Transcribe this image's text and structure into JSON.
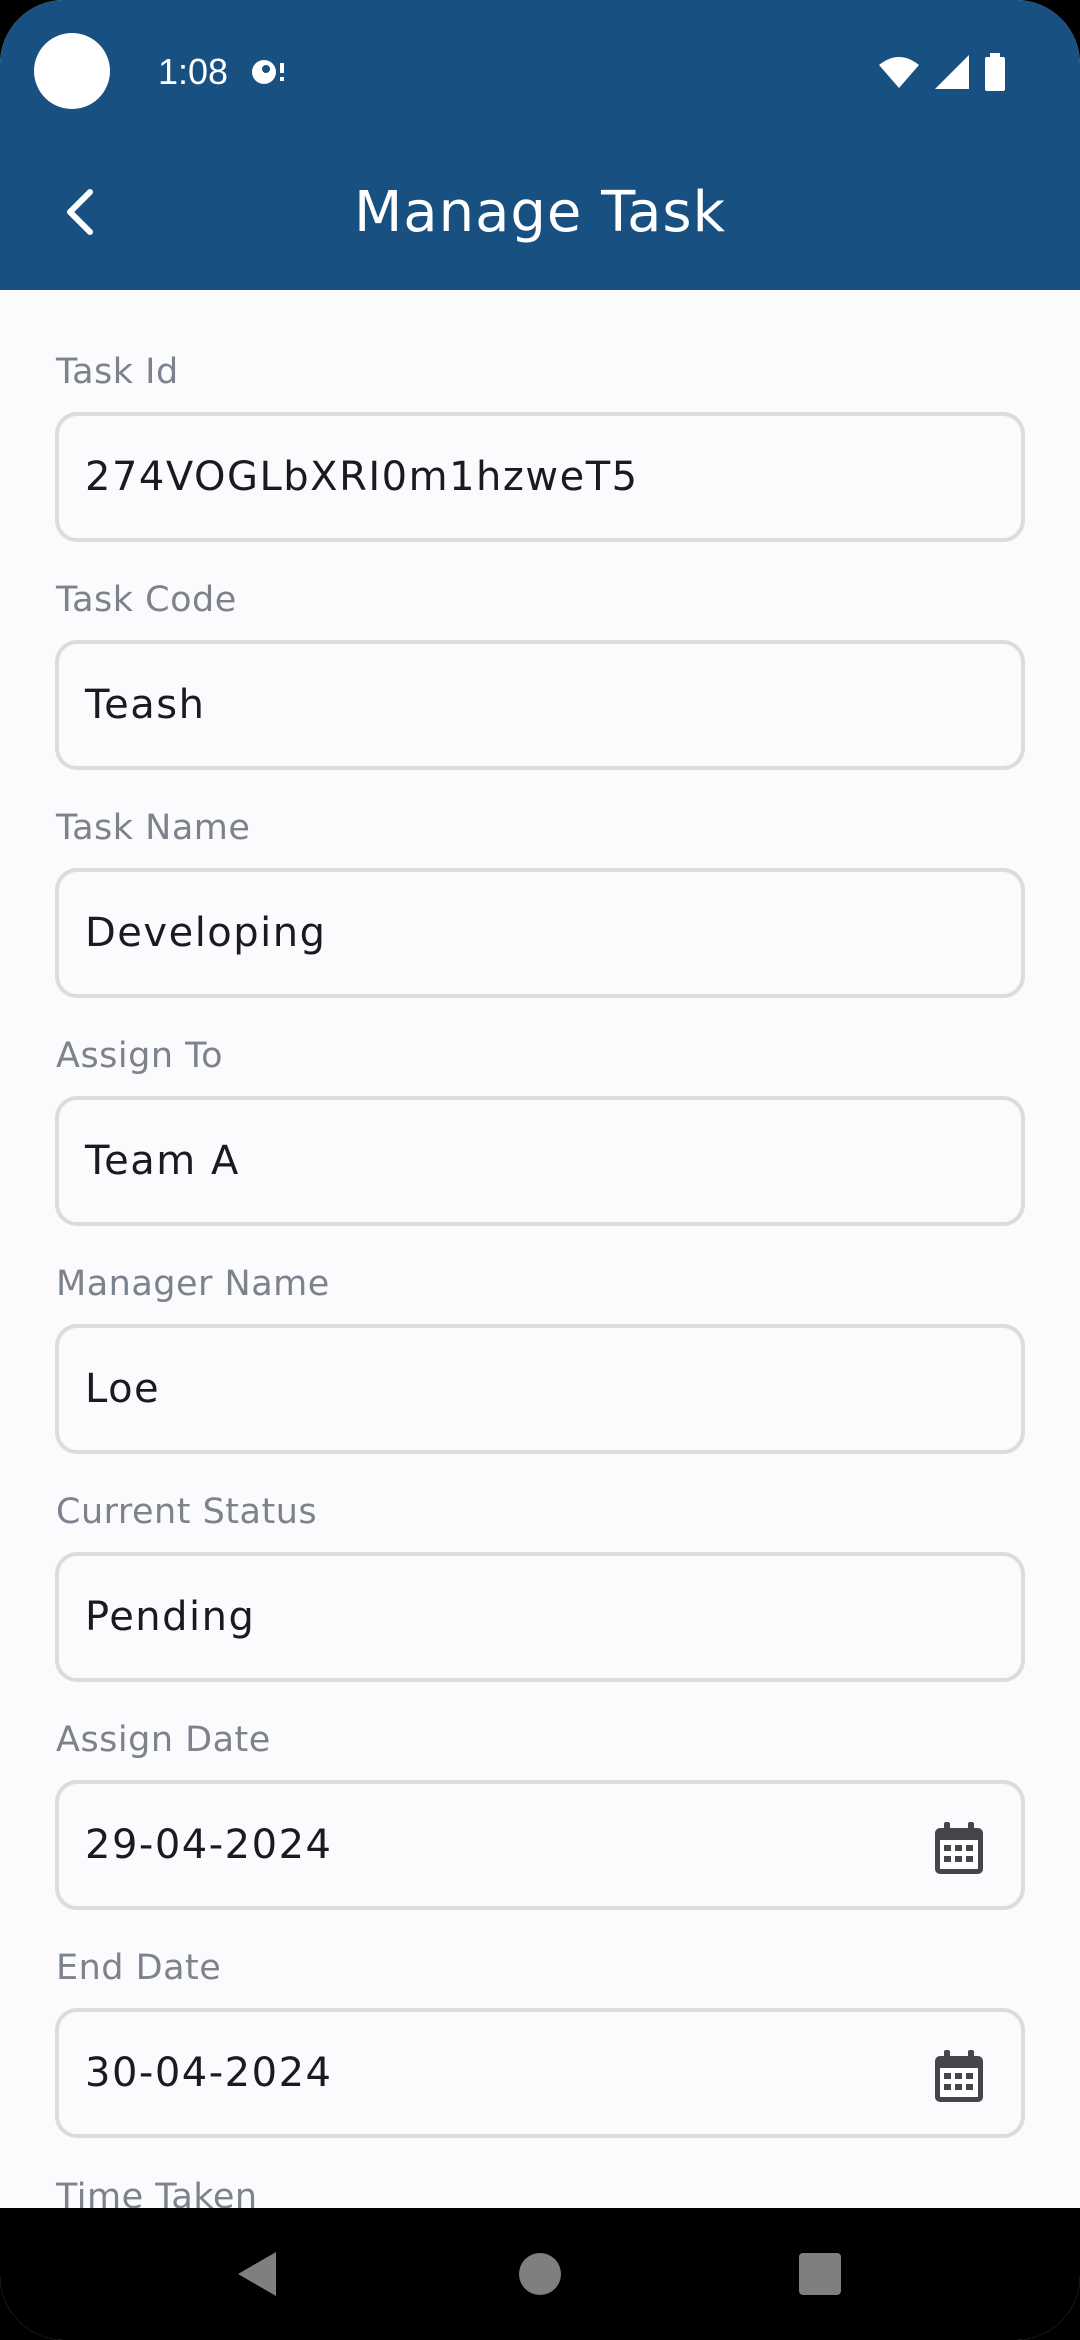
{
  "status_bar": {
    "time": "1:08"
  },
  "app_bar": {
    "title": "Manage Task"
  },
  "fields": [
    {
      "label": "Task Id",
      "value": "274VOGLbXRI0m1hzweT5"
    },
    {
      "label": "Task Code",
      "value": "Teash"
    },
    {
      "label": "Task Name",
      "value": "Developing"
    },
    {
      "label": "Assign To",
      "value": "Team A"
    },
    {
      "label": "Manager Name",
      "value": "Loe"
    },
    {
      "label": "Current Status",
      "value": "Pending"
    },
    {
      "label": "Assign Date",
      "value": "29-04-2024",
      "icon": "calendar-icon"
    },
    {
      "label": "End Date",
      "value": "30-04-2024",
      "icon": "calendar-icon"
    }
  ],
  "partial_field": {
    "label": "Time Taken"
  },
  "colors": {
    "primary": "#185081",
    "background": "#FBFAFD",
    "label": "#7C838D",
    "border": "#DCDCDE"
  }
}
